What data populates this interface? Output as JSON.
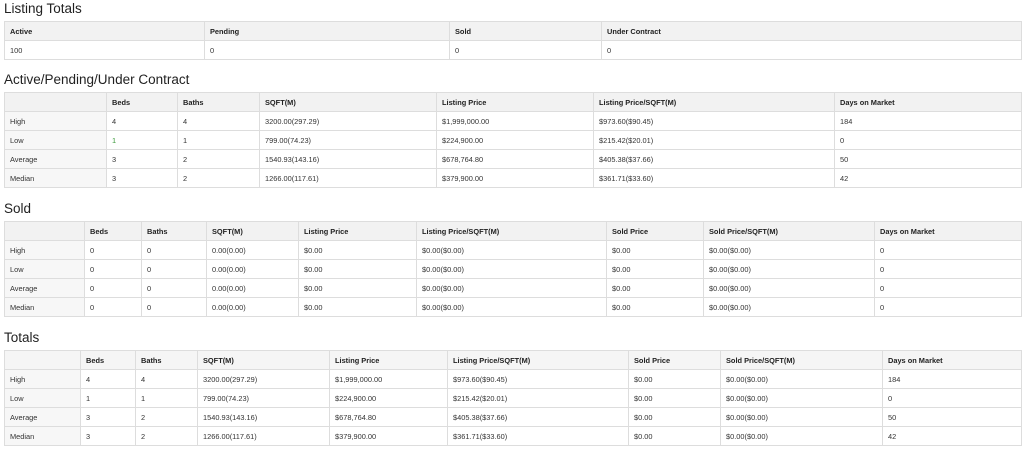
{
  "listing_totals": {
    "title": "Listing Totals",
    "headers": [
      "Active",
      "Pending",
      "Sold",
      "Under Contract"
    ],
    "values": [
      "100",
      "0",
      "0",
      "0"
    ]
  },
  "apuc": {
    "title": "Active/Pending/Under Contract",
    "headers": [
      "",
      "Beds",
      "Baths",
      "SQFT(M)",
      "Listing Price",
      "Listing Price/SQFT(M)",
      "Days on Market"
    ],
    "rows": [
      [
        "High",
        "4",
        "4",
        "3200.00(297.29)",
        "$1,999,000.00",
        "$973.60($90.45)",
        "184"
      ],
      [
        "Low",
        "1",
        "1",
        "799.00(74.23)",
        "$224,900.00",
        "$215.42($20.01)",
        "0"
      ],
      [
        "Average",
        "3",
        "2",
        "1540.93(143.16)",
        "$678,764.80",
        "$405.38($37.66)",
        "50"
      ],
      [
        "Median",
        "3",
        "2",
        "1266.00(117.61)",
        "$379,900.00",
        "$361.71($33.60)",
        "42"
      ]
    ]
  },
  "sold": {
    "title": "Sold",
    "headers": [
      "",
      "Beds",
      "Baths",
      "SQFT(M)",
      "Listing Price",
      "Listing Price/SQFT(M)",
      "Sold Price",
      "Sold Price/SQFT(M)",
      "Days on Market"
    ],
    "rows": [
      [
        "High",
        "0",
        "0",
        "0.00(0.00)",
        "$0.00",
        "$0.00($0.00)",
        "$0.00",
        "$0.00($0.00)",
        "0"
      ],
      [
        "Low",
        "0",
        "0",
        "0.00(0.00)",
        "$0.00",
        "$0.00($0.00)",
        "$0.00",
        "$0.00($0.00)",
        "0"
      ],
      [
        "Average",
        "0",
        "0",
        "0.00(0.00)",
        "$0.00",
        "$0.00($0.00)",
        "$0.00",
        "$0.00($0.00)",
        "0"
      ],
      [
        "Median",
        "0",
        "0",
        "0.00(0.00)",
        "$0.00",
        "$0.00($0.00)",
        "$0.00",
        "$0.00($0.00)",
        "0"
      ]
    ]
  },
  "totals": {
    "title": "Totals",
    "headers": [
      "",
      "Beds",
      "Baths",
      "SQFT(M)",
      "Listing Price",
      "Listing Price/SQFT(M)",
      "Sold Price",
      "Sold Price/SQFT(M)",
      "Days on Market"
    ],
    "rows": [
      [
        "High",
        "4",
        "4",
        "3200.00(297.29)",
        "$1,999,000.00",
        "$973.60($90.45)",
        "$0.00",
        "$0.00($0.00)",
        "184"
      ],
      [
        "Low",
        "1",
        "1",
        "799.00(74.23)",
        "$224,900.00",
        "$215.42($20.01)",
        "$0.00",
        "$0.00($0.00)",
        "0"
      ],
      [
        "Average",
        "3",
        "2",
        "1540.93(143.16)",
        "$678,764.80",
        "$405.38($37.66)",
        "$0.00",
        "$0.00($0.00)",
        "50"
      ],
      [
        "Median",
        "3",
        "2",
        "1266.00(117.61)",
        "$379,900.00",
        "$361.71($33.60)",
        "$0.00",
        "$0.00($0.00)",
        "42"
      ]
    ]
  },
  "colors": {
    "accent_low_beds": "#3a9a3a",
    "border": "#dddddd",
    "header_bg": "#f2f2f2"
  }
}
